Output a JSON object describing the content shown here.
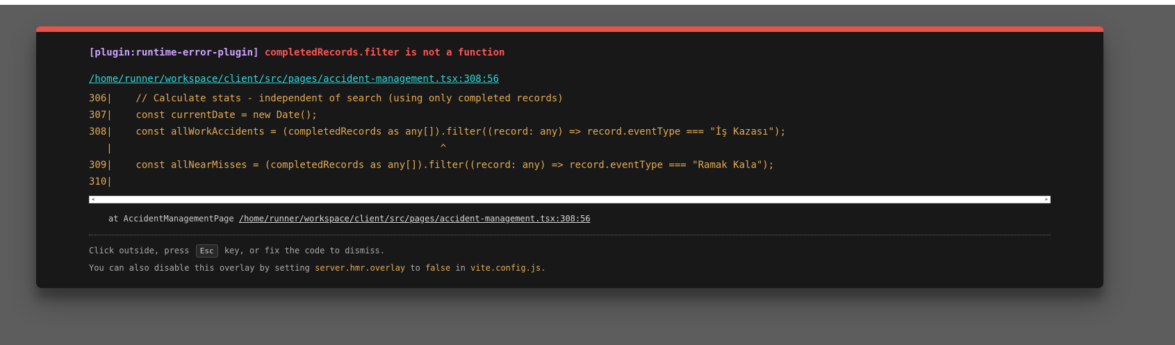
{
  "error": {
    "plugin": "[plugin:runtime-error-plugin]",
    "message": "completedRecords.filter is not a function",
    "file": "/home/runner/workspace/client/src/pages/accident-management.tsx:308:56"
  },
  "frame": [
    "306|    // Calculate stats - independent of search (using only completed records)",
    "307|    const currentDate = new Date();",
    "308|    const allWorkAccidents = (completedRecords as any[]).filter((record: any) => record.eventType === \"İş Kazası\");",
    "   |                                                        ^",
    "309|    const allNearMisses = (completedRecords as any[]).filter((record: any) => record.eventType === \"Ramak Kala\");",
    "310|"
  ],
  "stack": {
    "prefix": "at AccidentManagementPage ",
    "link": "/home/runner/workspace/client/src/pages/accident-management.tsx:308:56"
  },
  "tip": {
    "line1_before": "Click outside, press ",
    "esc_key": "Esc",
    "line1_after": " key, or fix the code to dismiss.",
    "line2_before": "You can also disable this overlay by setting ",
    "code1": "server.hmr.overlay",
    "mid1": " to ",
    "code2": "false",
    "mid2": " in ",
    "code3": "vite.config.js",
    "end": "."
  },
  "colors": {
    "accent_bar": "#e5534b",
    "plugin": "#cfa4ff",
    "message": "#ff5555",
    "file_link": "#2dd9da",
    "code_frame": "#e2aa53",
    "overlay_bg": "#181818",
    "backdrop": "#5d5d5d"
  }
}
